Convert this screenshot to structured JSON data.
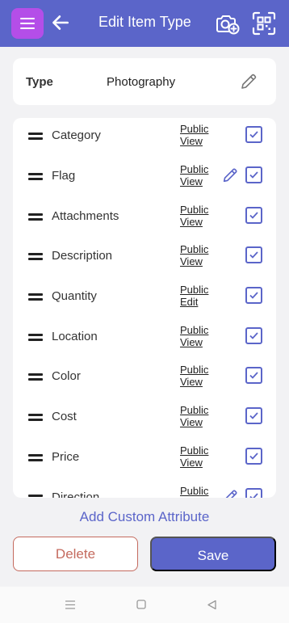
{
  "header": {
    "title": "Edit Item Type",
    "menu_icon": "hamburger-menu-icon",
    "back_icon": "arrow-left-icon",
    "camera_icon": "camera-add-icon",
    "scan_icon": "qr-scan-icon",
    "bar_color": "#5b65c9",
    "menu_color": "#b44ee8"
  },
  "type_card": {
    "label": "Type",
    "value": "Photography",
    "edit_icon": "pencil-icon"
  },
  "attributes": [
    {
      "name": "Category",
      "visibility_line1": "Public",
      "visibility_line2": "View",
      "checked": true,
      "edit_icon": false
    },
    {
      "name": "Flag",
      "visibility_line1": "Public",
      "visibility_line2": "View",
      "checked": true,
      "edit_icon": true
    },
    {
      "name": "Attachments",
      "visibility_line1": "Public",
      "visibility_line2": "View",
      "checked": true,
      "edit_icon": false
    },
    {
      "name": "Description",
      "visibility_line1": "Public",
      "visibility_line2": "View",
      "checked": true,
      "edit_icon": false
    },
    {
      "name": "Quantity",
      "visibility_line1": "Public",
      "visibility_line2": "Edit",
      "checked": true,
      "edit_icon": false
    },
    {
      "name": "Location",
      "visibility_line1": "Public",
      "visibility_line2": "View",
      "checked": true,
      "edit_icon": false
    },
    {
      "name": "Color",
      "visibility_line1": "Public",
      "visibility_line2": "View",
      "checked": true,
      "edit_icon": false
    },
    {
      "name": "Cost",
      "visibility_line1": "Public",
      "visibility_line2": "View",
      "checked": true,
      "edit_icon": false
    },
    {
      "name": "Price",
      "visibility_line1": "Public",
      "visibility_line2": "View",
      "checked": true,
      "edit_icon": false
    },
    {
      "name": "Direction",
      "visibility_line1": "Public",
      "visibility_line2": "",
      "checked": true,
      "edit_icon": true
    }
  ],
  "actions": {
    "add_custom_attribute": "Add Custom Attribute",
    "delete": "Delete",
    "save": "Save",
    "accent_color": "#5b65c9",
    "delete_color": "#c46a5e"
  },
  "system_nav": {
    "menu_icon": "recents-icon",
    "home_icon": "home-square-icon",
    "back_icon": "back-triangle-icon"
  }
}
